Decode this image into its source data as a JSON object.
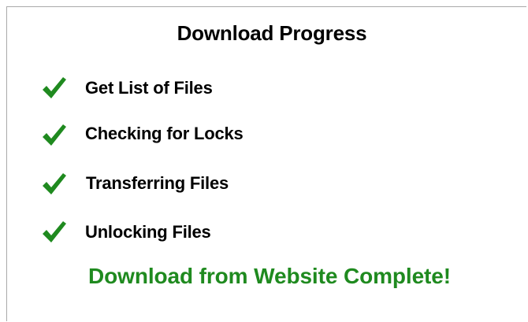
{
  "dialog": {
    "title": "Download Progress",
    "steps": [
      {
        "label": "Get List of Files",
        "status": "done",
        "icon": "checkmark-icon"
      },
      {
        "label": "Checking for Locks",
        "status": "done",
        "icon": "checkmark-icon"
      },
      {
        "label": "Transferring Files",
        "status": "done",
        "icon": "checkmark-icon"
      },
      {
        "label": "Unlocking Files",
        "status": "done",
        "icon": "checkmark-icon"
      }
    ],
    "complete_message": "Download from Website Complete!"
  },
  "colors": {
    "check": "#1f8a1f",
    "complete_text": "#1f8a1f",
    "text": "#000000",
    "background": "#ffffff",
    "border": "#a9a9a9"
  }
}
